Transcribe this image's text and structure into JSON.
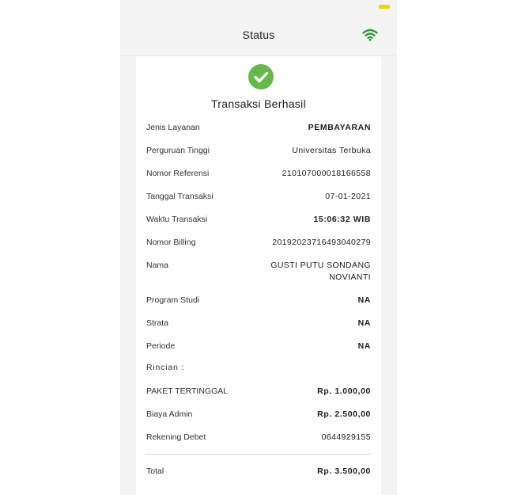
{
  "header": {
    "title": "Status",
    "icon": "wifi-icon"
  },
  "colors": {
    "success": "#66b84a",
    "wifi": "#2e9a3c",
    "battery": "#f2cf10"
  },
  "card": {
    "icon": "check-circle-icon",
    "title": "Transaksi Berhasil",
    "rows": [
      {
        "label": "Jenis Layanan",
        "value": "PEMBAYARAN"
      },
      {
        "label": "Perguruan Tinggi",
        "value": "Universitas Terbuka"
      },
      {
        "label": "Nomor Referensi",
        "value": "210107000018166558"
      },
      {
        "label": "Tanggal Transaksi",
        "value": "07-01-2021"
      },
      {
        "label": "Waktu Transaksi",
        "value": "15:06:32 WIB"
      },
      {
        "label": "Nomor Billing",
        "value": "20192023716493040279"
      },
      {
        "label": "Nama",
        "value_line1": "GUSTI PUTU SONDANG",
        "value_line2": "NOVIANTI"
      },
      {
        "label": "Program Studi",
        "value": "NA"
      },
      {
        "label": "Strata",
        "value": "NA"
      },
      {
        "label": "Periode",
        "value": "NA"
      }
    ],
    "details_label": "Rincian :",
    "details": [
      {
        "label": "PAKET TERTINGGAL",
        "value": "Rp. 1.000,00"
      },
      {
        "label": "Biaya Admin",
        "value": "Rp. 2.500,00"
      },
      {
        "label": "Rekening Debet",
        "value": "0644929155"
      }
    ],
    "total": {
      "label": "Total",
      "value": "Rp. 3.500,00"
    }
  }
}
